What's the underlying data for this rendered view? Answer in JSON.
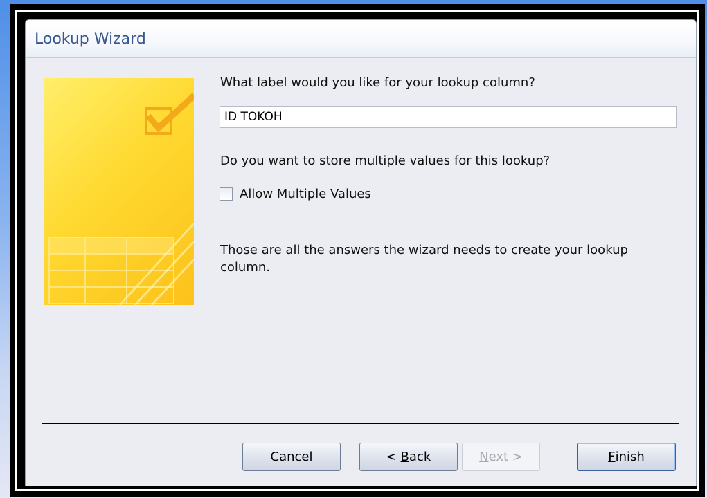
{
  "window": {
    "title": "Lookup Wizard"
  },
  "banner": {
    "icon": "checkbox-table-illustration"
  },
  "form": {
    "label_prompt": "What label would you like for your lookup column?",
    "label_value": "ID TOKOH",
    "multi_prompt": "Do you want to store multiple values for this lookup?",
    "allow_multiple_label_prefix": "",
    "allow_multiple_mnemonic": "A",
    "allow_multiple_label_rest": "llow Multiple Values",
    "allow_multiple_checked": false,
    "info_text": "Those are all the answers the wizard needs to create your lookup column."
  },
  "buttons": {
    "cancel": "Cancel",
    "back_prefix": "< ",
    "back_mnemonic": "B",
    "back_rest": "ack",
    "next_mnemonic": "N",
    "next_rest": "ext >",
    "finish_mnemonic": "F",
    "finish_rest": "inish"
  },
  "colors": {
    "title_text": "#36578f",
    "banner_yellow": "#ffd930",
    "dialog_bg": "#ecedf3"
  }
}
